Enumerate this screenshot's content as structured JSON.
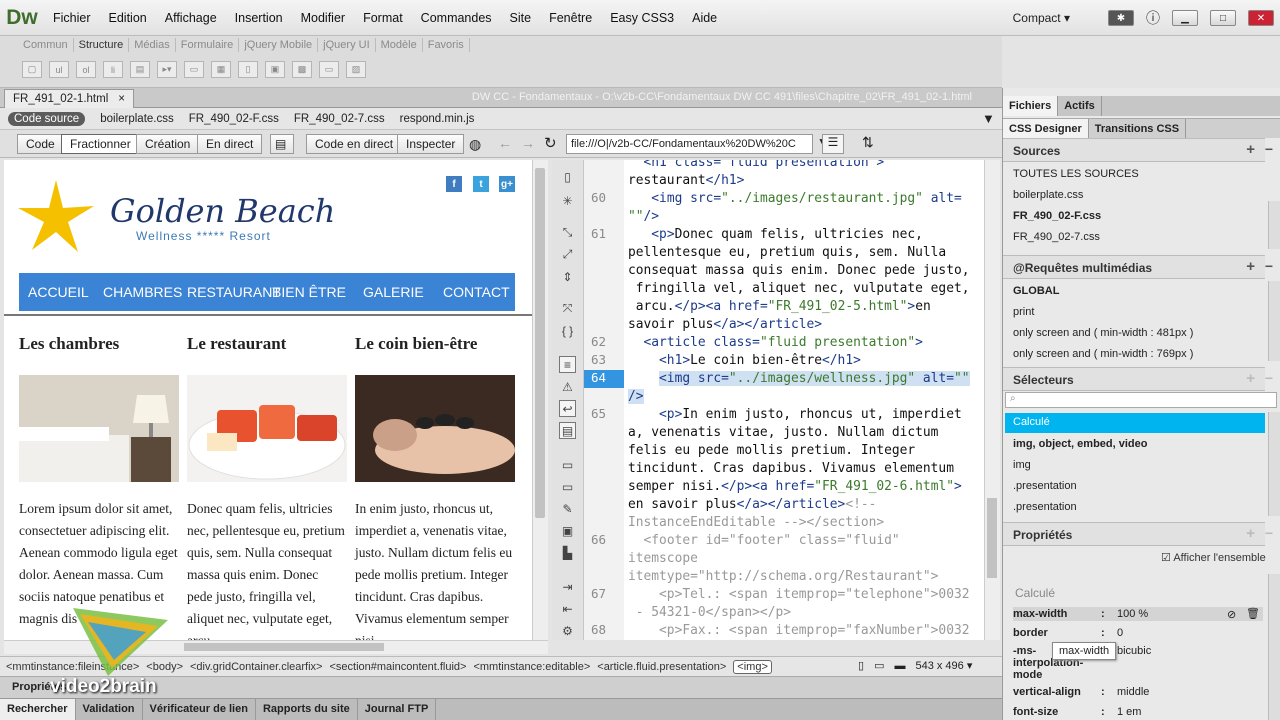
{
  "app": {
    "logo": "Dw",
    "menu": [
      "Fichier",
      "Edition",
      "Affichage",
      "Insertion",
      "Modifier",
      "Format",
      "Commandes",
      "Site",
      "Fenêtre",
      "Easy CSS3",
      "Aide"
    ],
    "workspace": "Compact ▾"
  },
  "insert": {
    "tabs": [
      "Commun",
      "Structure",
      "Médias",
      "Formulaire",
      "jQuery Mobile",
      "jQuery UI",
      "Modèle",
      "Favoris"
    ]
  },
  "doc": {
    "tab": "FR_491_02-1.html",
    "close": "×",
    "path": "DW CC - Fondamentaux - O:\\v2b-CC\\Fondamentaux DW CC 491\\files\\Chapitre_02\\FR_491_02-1.html"
  },
  "related": [
    "Code source",
    "boilerplate.css",
    "FR_490_02-F.css",
    "FR_490_02-7.css",
    "respond.min.js"
  ],
  "toolbar": {
    "code": "Code",
    "split": "Fractionner",
    "design": "Création",
    "live": "En direct",
    "livecode": "Code en direct",
    "inspect": "Inspecter",
    "url": "file:///O|/v2b-CC/Fondamentaux%20DW%20C"
  },
  "site": {
    "name": "Golden Beach",
    "subtitle": "Wellness ***** Resort",
    "social": [
      "f",
      "t",
      "g+"
    ],
    "nav": [
      "ACCUEIL",
      "CHAMBRES",
      "RESTAURANT",
      "BIEN ÊTRE",
      "GALERIE",
      "CONTACT"
    ],
    "cols": [
      {
        "h": "Les chambres",
        "text": "Lorem ipsum dolor sit amet, consectetuer adipiscing elit. Aenean commodo ligula eget dolor. Aenean massa. Cum sociis natoque penatibus et magnis dis"
      },
      {
        "h": "Le restaurant",
        "text": "Donec quam felis, ultricies nec, pellentesque eu, pretium quis, sem. Nulla consequat massa quis enim. Donec pede justo, fringilla vel, aliquet nec, vulputate eget, arcu."
      },
      {
        "h": "Le coin bien-être",
        "text": "In enim justo, rhoncus ut, imperdiet a, venenatis vitae, justo. Nullam dictum felis eu pede mollis pretium. Integer tincidunt. Cras dapibus. Vivamus elementum semper nisi."
      }
    ]
  },
  "code": {
    "lines": [
      {
        "n": "",
        "html": "<span class='t'>  &lt;h1 class=\"fluid presentation\"&gt;</span>"
      },
      {
        "n": "",
        "html": "restaurant<span class='t'>&lt;/h1&gt;</span>"
      },
      {
        "n": "60",
        "html": "   <span class='t'>&lt;img src=</span><span class='s'>\"../images/restaurant.jpg\"</span><span class='t'> alt=</span>"
      },
      {
        "n": "",
        "html": "<span class='s'>\"\"</span><span class='t'>/&gt;</span>"
      },
      {
        "n": "61",
        "html": "   <span class='t'>&lt;p&gt;</span>Donec quam felis, ultricies nec,"
      },
      {
        "n": "",
        "html": "pellentesque eu, pretium quis, sem. Nulla"
      },
      {
        "n": "",
        "html": "consequat massa quis enim. Donec pede justo,"
      },
      {
        "n": "",
        "html": " fringilla vel, aliquet nec, vulputate eget,"
      },
      {
        "n": "",
        "html": " arcu.<span class='t'>&lt;/p&gt;&lt;a href=</span><span class='s'>\"FR_491_02-5.html\"</span><span class='t'>&gt;</span>en"
      },
      {
        "n": "",
        "html": "savoir plus<span class='t'>&lt;/a&gt;&lt;/article&gt;</span>"
      },
      {
        "n": "62",
        "html": "  <span class='t'>&lt;article class=</span><span class='s'>\"fluid presentation\"</span><span class='t'>&gt;</span>"
      },
      {
        "n": "63",
        "html": "    <span class='t'>&lt;h1&gt;</span>Le coin bien-être<span class='t'>&lt;/h1&gt;</span>"
      },
      {
        "n": "64",
        "html": "    <span class='hl'><span class='t'>&lt;img src=</span><span class='s'>\"../images/wellness.jpg\"</span><span class='t'> alt=</span><span class='s'>\"\"</span></span>",
        "cur": true
      },
      {
        "n": "",
        "html": "<span class='hl'><span class='t'>/&gt;</span></span>"
      },
      {
        "n": "65",
        "html": "    <span class='t'>&lt;p&gt;</span>In enim justo, rhoncus ut, imperdiet"
      },
      {
        "n": "",
        "html": "a, venenatis vitae, justo. Nullam dictum"
      },
      {
        "n": "",
        "html": "felis eu pede mollis pretium. Integer"
      },
      {
        "n": "",
        "html": "tincidunt. Cras dapibus. Vivamus elementum"
      },
      {
        "n": "",
        "html": "semper nisi.<span class='t'>&lt;/p&gt;&lt;a href=</span><span class='s'>\"FR_491_02-6.html\"</span><span class='t'>&gt;</span>"
      },
      {
        "n": "",
        "html": "en savoir plus<span class='t'>&lt;/a&gt;&lt;/article&gt;</span><span class='c'>&lt;!--</span>"
      },
      {
        "n": "",
        "html": "<span class='c'>InstanceEndEditable --&gt;&lt;/section&gt;</span>"
      },
      {
        "n": "66",
        "html": "  <span class='c'>&lt;footer id=\"footer\" class=\"fluid\"</span>"
      },
      {
        "n": "",
        "html": "<span class='c'>itemscope</span>"
      },
      {
        "n": "",
        "html": "<span class='c'>itemtype=\"http://schema.org/Restaurant\"&gt;</span>"
      },
      {
        "n": "67",
        "html": "    <span class='c'>&lt;p&gt;Tel.: &lt;span itemprop=\"telephone\"&gt;0032</span>"
      },
      {
        "n": "",
        "html": "<span class='c'> - 54321-0&lt;/span&gt;&lt;/p&gt;</span>"
      },
      {
        "n": "68",
        "html": "    <span class='c'>&lt;p&gt;Fax.: &lt;span itemprop=\"faxNumber\"&gt;0032</span>"
      }
    ]
  },
  "tagsel": [
    "<mmtinstance:fileinstance>",
    "<body>",
    "<div.gridContainer.clearfix>",
    "<section#maincontent.fluid>",
    "<mmtinstance:editable>",
    "<article.fluid.presentation>"
  ],
  "tagsel_sel": "<img>",
  "size": "543 x 496 ▾",
  "props_label": "Propriétés",
  "bottom_tabs": [
    "Rechercher",
    "Validation",
    "Vérificateur de lien",
    "Rapports du site",
    "Journal FTP"
  ],
  "panel": {
    "tabs": [
      "Fichiers",
      "Actifs"
    ],
    "tabs2": [
      "CSS Designer",
      "Transitions CSS"
    ],
    "sources_h": "Sources",
    "sources": [
      "TOUTES LES SOURCES",
      "boilerplate.css",
      "FR_490_02-F.css",
      "FR_490_02-7.css"
    ],
    "media_h": "@Requêtes multimédias",
    "media": [
      "GLOBAL",
      "print",
      "only screen and ( min-width : 481px )",
      "only screen and ( min-width : 769px )"
    ],
    "sel_h": "Sélecteurs",
    "selectors": [
      "Calculé",
      "img, object, embed, video",
      "img",
      ".presentation",
      ".presentation"
    ],
    "props_h": "Propriétés",
    "show_all": "Afficher l'ensemble",
    "computed": "Calculé",
    "props": [
      {
        "name": "max-width",
        "val": "100 %"
      },
      {
        "name": "border",
        "val": "0"
      },
      {
        "name": "-ms-interpolation-mode",
        "val": "bicubic"
      },
      {
        "name": "vertical-align",
        "val": "middle"
      },
      {
        "name": "font-size",
        "val": "1 em"
      }
    ],
    "tooltip": "max-width"
  },
  "watermark": "video2brain"
}
